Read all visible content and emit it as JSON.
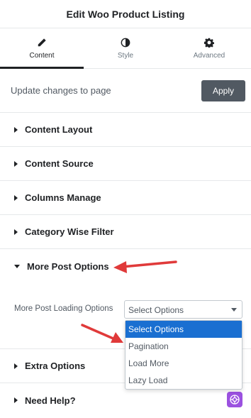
{
  "header": {
    "title": "Edit Woo Product Listing"
  },
  "tabs": [
    {
      "label": "Content",
      "icon": "pencil-icon",
      "active": true
    },
    {
      "label": "Style",
      "icon": "contrast-icon",
      "active": false
    },
    {
      "label": "Advanced",
      "icon": "gear-icon",
      "active": false
    }
  ],
  "update": {
    "text": "Update changes to page",
    "button": "Apply"
  },
  "sections": [
    {
      "label": "Content Layout",
      "open": false
    },
    {
      "label": "Content Source",
      "open": false
    },
    {
      "label": "Columns Manage",
      "open": false
    },
    {
      "label": "Category Wise Filter",
      "open": false
    },
    {
      "label": "More Post Options",
      "open": true
    },
    {
      "label": "Extra Options",
      "open": false
    },
    {
      "label": "Need Help?",
      "open": false
    }
  ],
  "more_post": {
    "control_label": "More Post Loading Options",
    "select_value": "Select Options",
    "options": [
      "Select Options",
      "Pagination",
      "Load More",
      "Lazy Load"
    ],
    "selected_option": "Select Options"
  },
  "colors": {
    "accent_select": "#1a6fd1",
    "annotation_arrow": "#e03a3a",
    "help_badge": "#9b51e0",
    "apply_button": "#515962"
  }
}
